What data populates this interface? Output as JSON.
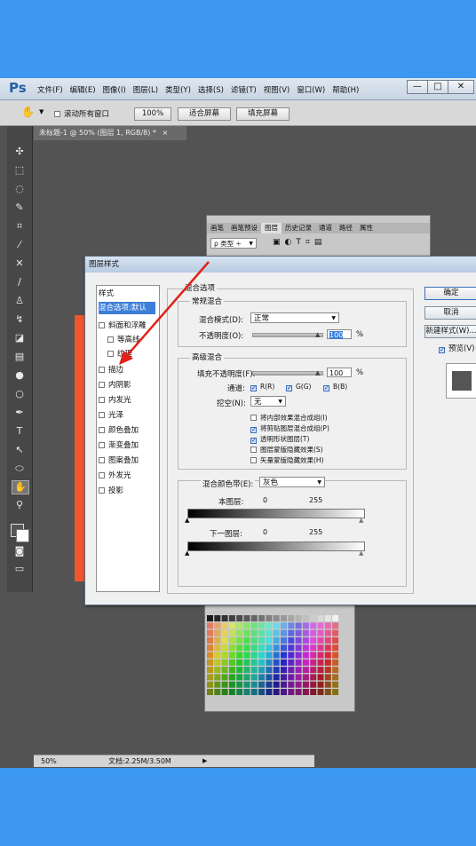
{
  "app": {
    "logo": "Ps",
    "menu": [
      "文件(F)",
      "编辑(E)",
      "图像(I)",
      "图层(L)",
      "类型(Y)",
      "选择(S)",
      "滤镜(T)",
      "视图(V)",
      "窗口(W)",
      "帮助(H)"
    ],
    "win_min": "—",
    "win_max": "□",
    "win_close": "✕"
  },
  "options": {
    "scroll_all": "滚动所有窗口",
    "zoom_100": "100%",
    "fit_screen": "适合屏幕",
    "fill_screen": "填充屏幕"
  },
  "doc": {
    "tab": "未标题-1 @ 50% (图层 1, RGB/8) *",
    "tab_close": "×"
  },
  "panel": {
    "tabs": [
      "画笔",
      "画笔预设",
      "图层",
      "历史记录",
      "通道",
      "路径",
      "属性"
    ],
    "kind": "ρ 类型 ÷"
  },
  "dialog": {
    "title": "图层样式",
    "styles_header": "样式",
    "styles": [
      {
        "label": "混合选项:默认",
        "selected": true,
        "checkbox": false
      },
      {
        "label": "斜面和浮雕",
        "checkbox": true,
        "checked": false
      },
      {
        "label": "等高线",
        "checkbox": true,
        "checked": false,
        "indent": true
      },
      {
        "label": "纹理",
        "checkbox": true,
        "checked": false,
        "indent": true
      },
      {
        "label": "描边",
        "checkbox": true,
        "checked": false
      },
      {
        "label": "内阴影",
        "checkbox": true,
        "checked": false
      },
      {
        "label": "内发光",
        "checkbox": true,
        "checked": false
      },
      {
        "label": "光泽",
        "checkbox": true,
        "checked": false
      },
      {
        "label": "颜色叠加",
        "checkbox": true,
        "checked": false
      },
      {
        "label": "渐变叠加",
        "checkbox": true,
        "checked": false
      },
      {
        "label": "图案叠加",
        "checkbox": true,
        "checked": false
      },
      {
        "label": "外发光",
        "checkbox": true,
        "checked": false
      },
      {
        "label": "投影",
        "checkbox": true,
        "checked": false
      }
    ],
    "blend_options": "混合选项",
    "general": "常规混合",
    "blend_mode_label": "混合模式(D):",
    "blend_mode": "正常",
    "opacity_label": "不透明度(O):",
    "opacity": "100",
    "pct": "%",
    "advanced": "高级混合",
    "fill_opacity_label": "填充不透明度(F):",
    "fill_opacity": "100",
    "channels_label": "通道:",
    "ch_r": "R(R)",
    "ch_g": "G(G)",
    "ch_b": "B(B)",
    "knockout_label": "挖空(N):",
    "knockout": "无",
    "opts": [
      {
        "label": "将内部效果混合成组(I)",
        "checked": false
      },
      {
        "label": "将剪贴图层混合成组(P)",
        "checked": true
      },
      {
        "label": "透明形状图层(T)",
        "checked": true
      },
      {
        "label": "图层蒙版隐藏效果(S)",
        "checked": false
      },
      {
        "label": "矢量蒙版隐藏效果(H)",
        "checked": false
      }
    ],
    "blend_if_label": "混合颜色带(E):",
    "blend_if": "灰色",
    "this_layer": "本图层:",
    "underlying": "下一图层:",
    "v0": "0",
    "v255": "255",
    "ok": "确定",
    "cancel": "取消",
    "new_style": "新建样式(W)...",
    "preview": "预览(V)"
  },
  "status": {
    "zoom": "50%",
    "doc_size": "文档:2.25M/3.50M"
  }
}
